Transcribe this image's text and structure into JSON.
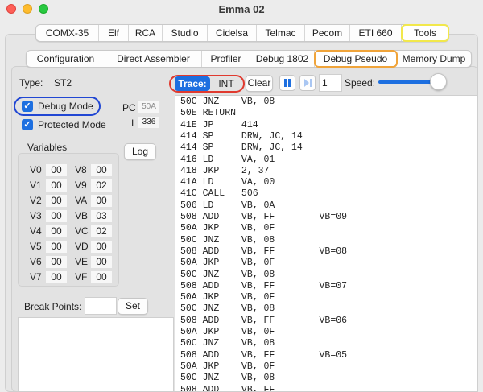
{
  "window": {
    "title": "Emma 02"
  },
  "main_tabs": [
    "COMX-35",
    "Elf",
    "RCA",
    "Studio",
    "Cidelsa",
    "Telmac",
    "Pecom",
    "ETI 660",
    "Tools"
  ],
  "sub_tabs": [
    "Configuration",
    "Direct Assembler",
    "Profiler",
    "Debug 1802",
    "Debug Pseudo",
    "Memory Dump"
  ],
  "left": {
    "type_label": "Type:",
    "type_value": "ST2",
    "debug_mode": "Debug Mode",
    "protected_mode": "Protected Mode",
    "pc_label": "PC",
    "pc_value": "50A",
    "i_label": "I",
    "i_value": "336",
    "variables_label": "Variables",
    "log_button": "Log",
    "break_points_label": "Break Points:",
    "set_button": "Set"
  },
  "variables": [
    {
      "name": "V0",
      "value": "00"
    },
    {
      "name": "V8",
      "value": "00"
    },
    {
      "name": "V1",
      "value": "00"
    },
    {
      "name": "V9",
      "value": "02"
    },
    {
      "name": "V2",
      "value": "00"
    },
    {
      "name": "VA",
      "value": "00"
    },
    {
      "name": "V3",
      "value": "00"
    },
    {
      "name": "VB",
      "value": "03"
    },
    {
      "name": "V4",
      "value": "00"
    },
    {
      "name": "VC",
      "value": "02"
    },
    {
      "name": "V5",
      "value": "00"
    },
    {
      "name": "VD",
      "value": "00"
    },
    {
      "name": "V6",
      "value": "00"
    },
    {
      "name": "VE",
      "value": "00"
    },
    {
      "name": "V7",
      "value": "00"
    },
    {
      "name": "VF",
      "value": "00"
    }
  ],
  "toolbar": {
    "trace": "Trace:",
    "int": "INT",
    "clear": "Clear",
    "step_value": "1",
    "speed_label": "Speed:",
    "speed_level_fraction": 0.9
  },
  "trace_lines": [
    "50C JNZ    VB, 08",
    "50E RETURN",
    "41E JP     414",
    "414 SP     DRW, JC, 14",
    "414 SP     DRW, JC, 14",
    "416 LD     VA, 01",
    "418 JKP    2, 37",
    "41A LD     VA, 00",
    "41C CALL   506",
    "506 LD     VB, 0A",
    "508 ADD    VB, FF        VB=09",
    "50A JKP    VB, 0F",
    "50C JNZ    VB, 08",
    "508 ADD    VB, FF        VB=08",
    "50A JKP    VB, 0F",
    "50C JNZ    VB, 08",
    "508 ADD    VB, FF        VB=07",
    "50A JKP    VB, 0F",
    "50C JNZ    VB, 08",
    "508 ADD    VB, FF        VB=06",
    "50A JKP    VB, 0F",
    "50C JNZ    VB, 08",
    "508 ADD    VB, FF        VB=05",
    "50A JKP    VB, 0F",
    "50C JNZ    VB, 08",
    "508 ADD    VB, FF"
  ],
  "colors": {
    "accent": "#1d6fe0",
    "highlight_yellow": "#f2e84b",
    "highlight_orange": "#f0a43a",
    "highlight_blue": "#2147d3",
    "highlight_red": "#e03a2f"
  }
}
